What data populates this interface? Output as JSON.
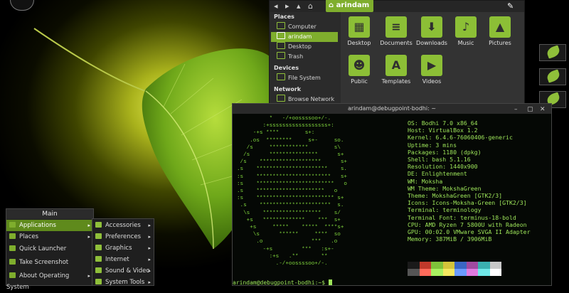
{
  "colors": {
    "accent": "#7fae2d",
    "terminal_text": "#9ee65a",
    "terminal_bg": "#050805"
  },
  "file_manager": {
    "path_label": "arindam",
    "sidebar": {
      "places_heading": "Places",
      "places": [
        "Computer",
        "arindam",
        "Desktop",
        "Trash"
      ],
      "selected": "arindam",
      "devices_heading": "Devices",
      "devices": [
        "File System"
      ],
      "network_heading": "Network",
      "network": [
        "Browse Network"
      ]
    },
    "folders": [
      {
        "label": "Desktop",
        "icon": "desktop-folder-icon"
      },
      {
        "label": "Documents",
        "icon": "documents-folder-icon"
      },
      {
        "label": "Downloads",
        "icon": "downloads-folder-icon"
      },
      {
        "label": "Music",
        "icon": "music-folder-icon"
      },
      {
        "label": "Pictures",
        "icon": "pictures-folder-icon"
      },
      {
        "label": "Public",
        "icon": "public-folder-icon"
      },
      {
        "label": "Templates",
        "icon": "templates-folder-icon"
      },
      {
        "label": "Videos",
        "icon": "videos-folder-icon"
      }
    ]
  },
  "terminal": {
    "title": "arindam@debugpoint-bodhi: ~",
    "ascii_logo": "          *   -/+oossssoo+/-.         \n        :+ssssssssssssssssss+:        \n     -+s ****        s+:              \n    .os  ********     s+-     so.     \n   /s     ************        s\\     \n  /s      ***************      s+     \n /s    *******************      s+    \n.s    **********************    s.   \n:s    ***********************   s+   \n:s    ************************   o   \n.s    *********************   o    \n:s    ************************ s+   \n .s    **********************  s.   \n  \\s    ******************    s/    \n   +s   *************    ***  s+    \n    +s     *****    *****  ****s+   \n     \\s      ******     ****  so    \n      .o               ***   .o     \n        -+s         ***   :s+-      \n          :+s   .**       **        \n            .-/+oossssoo+/-.        ",
    "specs": [
      "OS: Bodhi 7.0 x86_64",
      "Host: VirtualBox 1.2",
      "Kernel: 6.4.6-76060406-generic",
      "Uptime: 3 mins",
      "Packages: 1180 (dpkg)",
      "Shell: bash 5.1.16",
      "Resolution: 1440x900",
      "DE: Enlightenment",
      "WM: Moksha",
      "WM Theme: MokshaGreen",
      "Theme: MokshaGreen [GTK2/3]",
      "Icons: Icons-Moksha-Green [GTK2/3]",
      "Terminal: terminology",
      "Terminal Font: terminus-18-bold",
      "CPU: AMD Ryzen 7 5800U with Radeon",
      "GPU: 00:02.0 VMware SVGA II Adapter",
      "Memory: 387MiB / 3906MiB"
    ],
    "palette_top": [
      "#1a1a1a",
      "#c0392b",
      "#7fc23a",
      "#d4c43a",
      "#3a66c4",
      "#a04aa0",
      "#3ab0b0",
      "#c8c8c8"
    ],
    "palette_bottom": [
      "#555555",
      "#ff6b5b",
      "#a8f060",
      "#f4e860",
      "#6b9bff",
      "#e07ae0",
      "#70e8e8",
      "#ffffff"
    ],
    "prompt": "arindam@debugpoint-bodhi:~$ "
  },
  "main_menu": {
    "title": "Main",
    "items": [
      {
        "label": "Applications",
        "arrow": "▸",
        "selected": true
      },
      {
        "label": "Places",
        "arrow": "▸"
      },
      {
        "label": "Quick Launcher",
        "arrow": ""
      },
      {
        "label": "Take Screenshot",
        "arrow": ""
      },
      {
        "label": "About Operating System",
        "arrow": "▸"
      }
    ],
    "submenu": [
      {
        "label": "Accessories",
        "arrow": "▸"
      },
      {
        "label": "Preferences",
        "arrow": "▸"
      },
      {
        "label": "Graphics",
        "arrow": "▸"
      },
      {
        "label": "Internet",
        "arrow": "▸"
      },
      {
        "label": "Sound & Video",
        "arrow": "▸"
      },
      {
        "label": "System Tools",
        "arrow": "▸"
      }
    ]
  }
}
